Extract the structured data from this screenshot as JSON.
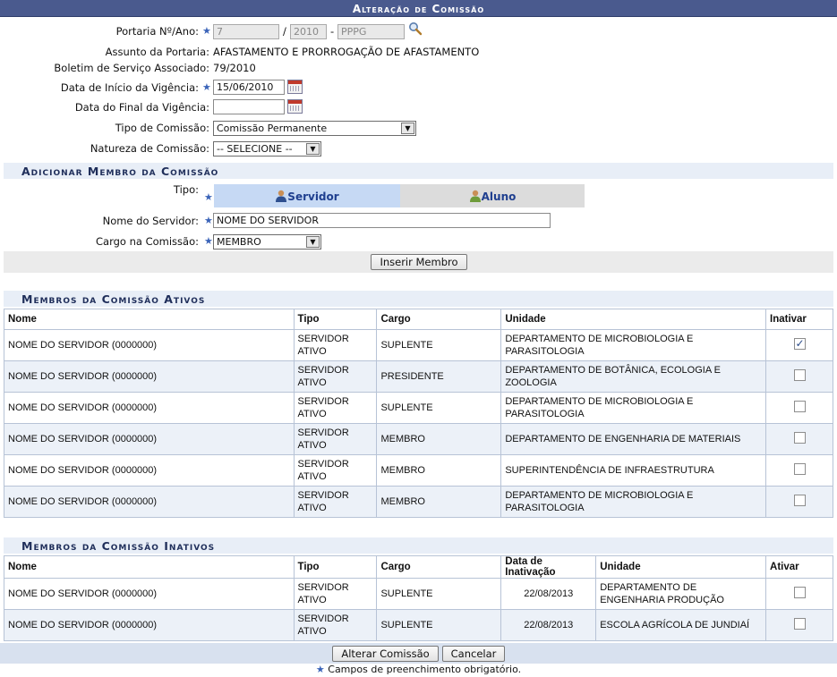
{
  "title": "Alteração de Comissão",
  "form": {
    "portaria_label": "Portaria Nº/Ano:",
    "portaria_num": "7",
    "portaria_sep": "/",
    "portaria_ano": "2010",
    "portaria_dash": "-",
    "portaria_sigla": "PPPG",
    "assunto_label": "Assunto da Portaria:",
    "assunto_value": "AFASTAMENTO E PRORROGAÇÃO DE AFASTAMENTO",
    "boletim_label": "Boletim de Serviço Associado:",
    "boletim_value": "79/2010",
    "inicio_label": "Data de Início da Vigência:",
    "inicio_value": "15/06/2010",
    "final_label": "Data do Final da Vigência:",
    "final_value": "",
    "tipo_label": "Tipo de Comissão:",
    "tipo_value": "Comissão Permanente",
    "natureza_label": "Natureza de Comissão:",
    "natureza_value": "-- SELECIONE --"
  },
  "add_member": {
    "header": "Adicionar Membro da Comissão",
    "tipo_label": "Tipo:",
    "tab_servidor": "Servidor",
    "tab_aluno": "Aluno",
    "nome_label": "Nome do Servidor:",
    "nome_value": "NOME DO SERVIDOR",
    "cargo_label": "Cargo na Comissão:",
    "cargo_value": "MEMBRO",
    "insert_button": "Inserir Membro"
  },
  "ativos": {
    "header": "Membros da Comissão Ativos",
    "columns": [
      "Nome",
      "Tipo",
      "Cargo",
      "Unidade",
      "Inativar"
    ],
    "rows": [
      {
        "nome": "NOME DO SERVIDOR (0000000)",
        "tipo": "SERVIDOR ATIVO",
        "cargo": "SUPLENTE",
        "unidade": "DEPARTAMENTO DE MICROBIOLOGIA E PARASITOLOGIA",
        "checked": true
      },
      {
        "nome": "NOME DO SERVIDOR (0000000)",
        "tipo": "SERVIDOR ATIVO",
        "cargo": "PRESIDENTE",
        "unidade": "DEPARTAMENTO DE BOTÂNICA, ECOLOGIA E ZOOLOGIA",
        "checked": false
      },
      {
        "nome": "NOME DO SERVIDOR (0000000)",
        "tipo": "SERVIDOR ATIVO",
        "cargo": "SUPLENTE",
        "unidade": "DEPARTAMENTO DE MICROBIOLOGIA E PARASITOLOGIA",
        "checked": false
      },
      {
        "nome": "NOME DO SERVIDOR (0000000)",
        "tipo": "SERVIDOR ATIVO",
        "cargo": "MEMBRO",
        "unidade": "DEPARTAMENTO DE ENGENHARIA DE MATERIAIS",
        "checked": false
      },
      {
        "nome": "NOME DO SERVIDOR (0000000)",
        "tipo": "SERVIDOR ATIVO",
        "cargo": "MEMBRO",
        "unidade": "SUPERINTENDÊNCIA DE INFRAESTRUTURA",
        "checked": false
      },
      {
        "nome": "NOME DO SERVIDOR (0000000)",
        "tipo": "SERVIDOR ATIVO",
        "cargo": "MEMBRO",
        "unidade": "DEPARTAMENTO DE MICROBIOLOGIA E PARASITOLOGIA",
        "checked": false
      }
    ]
  },
  "inativos": {
    "header": "Membros da Comissão Inativos",
    "columns": [
      "Nome",
      "Tipo",
      "Cargo",
      "Data de Inativação",
      "Unidade",
      "Ativar"
    ],
    "rows": [
      {
        "nome": "NOME DO SERVIDOR (0000000)",
        "tipo": "SERVIDOR ATIVO",
        "cargo": "SUPLENTE",
        "data": "22/08/2013",
        "unidade": "DEPARTAMENTO DE ENGENHARIA PRODUÇÃO",
        "checked": false
      },
      {
        "nome": "NOME DO SERVIDOR (0000000)",
        "tipo": "SERVIDOR ATIVO",
        "cargo": "SUPLENTE",
        "data": "22/08/2013",
        "unidade": "ESCOLA AGRÍCOLA DE JUNDIAÍ",
        "checked": false
      }
    ]
  },
  "footer": {
    "alterar_button": "Alterar Comissão",
    "cancelar_button": "Cancelar",
    "required_note": "Campos de preenchimento obrigatório."
  },
  "colors": {
    "title_bar": "#4a5a8e",
    "section_bg": "#e8eef7",
    "required_star": "#3a63b8"
  }
}
